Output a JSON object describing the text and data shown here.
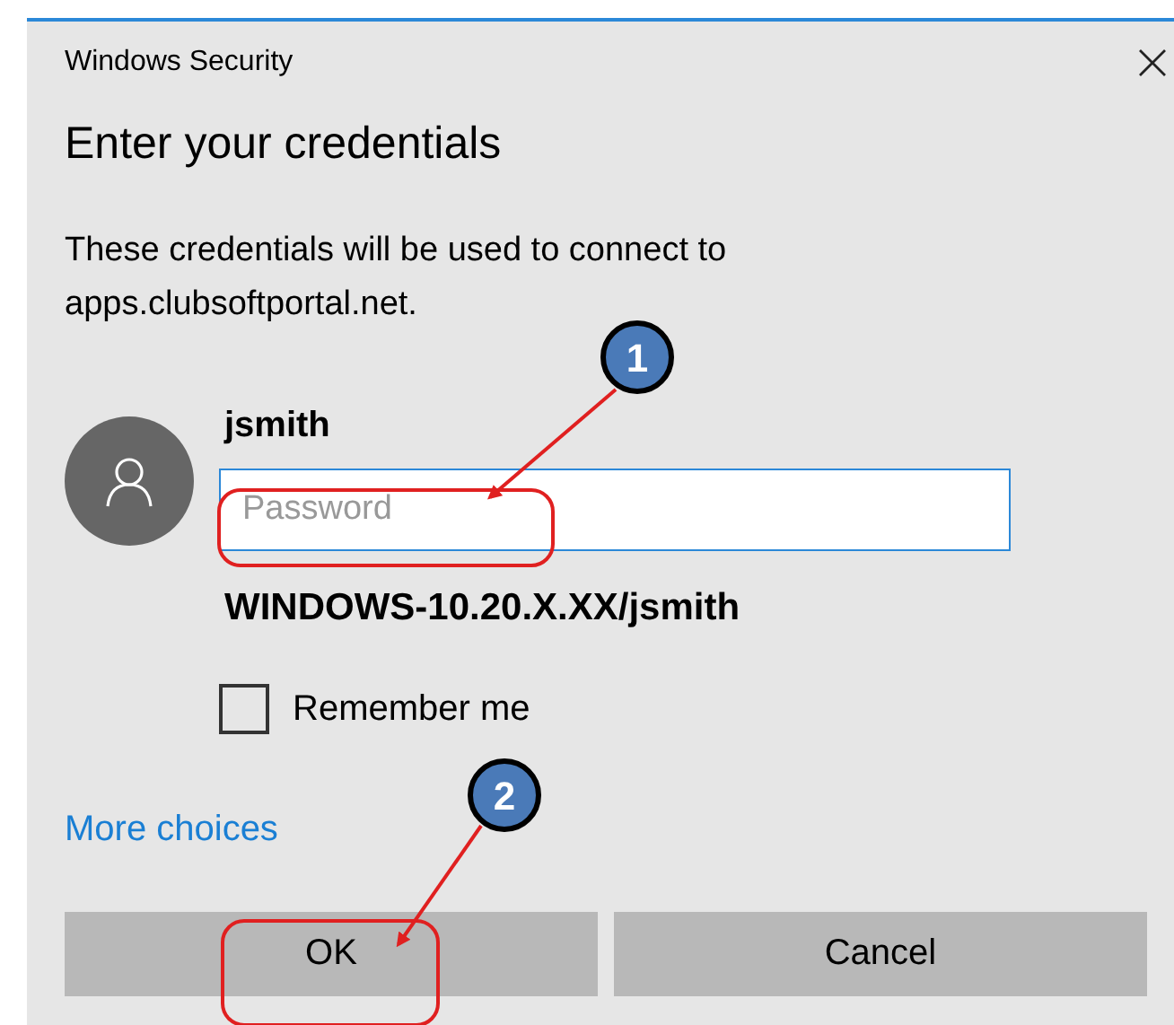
{
  "window": {
    "title": "Windows Security"
  },
  "heading": "Enter your credentials",
  "message": "These credentials will be used to connect to apps.clubsoftportal.net.",
  "user": {
    "name": "jsmith"
  },
  "password": {
    "placeholder": "Password"
  },
  "account": "WINDOWS-10.20.X.XX/jsmith",
  "remember": {
    "label": "Remember me",
    "checked": false
  },
  "more_link": "More choices",
  "buttons": [
    "OK",
    "Cancel"
  ],
  "callouts": [
    {
      "label": "1"
    },
    {
      "label": "2"
    }
  ]
}
